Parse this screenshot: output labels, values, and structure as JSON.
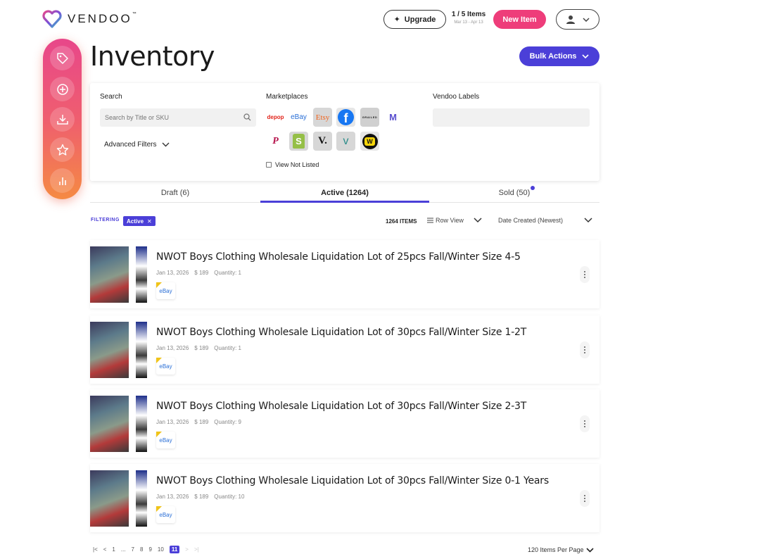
{
  "header": {
    "brand": "VENDOO",
    "brand_tm": "™",
    "upgrade_label": "Upgrade",
    "items_count": "1 / 5 Items",
    "items_period": "Mar 13 - Apr 13",
    "new_item_label": "New Item"
  },
  "page": {
    "title": "Inventory",
    "bulk_actions_label": "Bulk Actions"
  },
  "filters": {
    "search_label": "Search",
    "search_placeholder": "Search by Title or SKU",
    "advanced_filters_label": "Advanced Filters",
    "marketplaces_label": "Marketplaces",
    "marketplaces": [
      {
        "name": "depop",
        "text": "depop",
        "color": "#e2231a"
      },
      {
        "name": "ebay",
        "text": "eBay",
        "color": "#2a6fd6"
      },
      {
        "name": "etsy",
        "text": "Etsy",
        "color": "#f1641e"
      },
      {
        "name": "facebook",
        "text": "f",
        "color": "#1877f2"
      },
      {
        "name": "grailed",
        "text": "GRAILED",
        "color": "#222222"
      },
      {
        "name": "mercari",
        "text": "M",
        "color": "#5a4fcf"
      },
      {
        "name": "poshmark",
        "text": "P",
        "color": "#b5124b"
      },
      {
        "name": "shopify",
        "text": "S",
        "color": "#95bf47"
      },
      {
        "name": "vestiaire",
        "text": "V.",
        "color": "#111111"
      },
      {
        "name": "vinted",
        "text": "v",
        "color": "#2b8c89"
      },
      {
        "name": "whatnot",
        "text": "W",
        "color": "#111111"
      }
    ],
    "view_not_listed_label": "View Not Listed",
    "vendoo_labels_label": "Vendoo Labels"
  },
  "tabs": [
    {
      "label": "Draft (6)"
    },
    {
      "label": "Active (1264)"
    },
    {
      "label": "Sold (50)"
    }
  ],
  "list_controls": {
    "filtering_label": "FILTERING",
    "active_chip": "Active",
    "chip_close": "✕",
    "item_count": "1264 ITEMS",
    "view_label": "Row View",
    "sort_label": "Date Created (Newest)"
  },
  "items": [
    {
      "title": "NWOT Boys Clothing Wholesale Liquidation Lot of 25pcs Fall/Winter Size 4-5",
      "date": "Jan 13, 2026",
      "price": "$ 189",
      "quantity": "Quantity: 1",
      "marketplace": "eBay"
    },
    {
      "title": "NWOT Boys Clothing Wholesale Liquidation Lot of 30pcs Fall/Winter Size 1-2T",
      "date": "Jan 13, 2026",
      "price": "$ 189",
      "quantity": "Quantity: 1",
      "marketplace": "eBay"
    },
    {
      "title": "NWOT Boys Clothing Wholesale Liquidation Lot of 30pcs Fall/Winter Size 2-3T",
      "date": "Jan 13, 2026",
      "price": "$ 189",
      "quantity": "Quantity: 9",
      "marketplace": "eBay"
    },
    {
      "title": "NWOT Boys Clothing Wholesale Liquidation Lot of 30pcs Fall/Winter Size 0-1 Years",
      "date": "Jan 13, 2026",
      "price": "$ 189",
      "quantity": "Quantity: 10",
      "marketplace": "eBay"
    }
  ],
  "pagination": {
    "pages": [
      "1",
      "...",
      "7",
      "8",
      "9",
      "10"
    ],
    "current": "11",
    "per_page": "120 Items Per Page"
  },
  "colors": {
    "accent": "#4b3fd8",
    "new_item": "#ee3d7a",
    "sidebar_top": "#e8478a",
    "sidebar_bottom": "#f58a43"
  }
}
